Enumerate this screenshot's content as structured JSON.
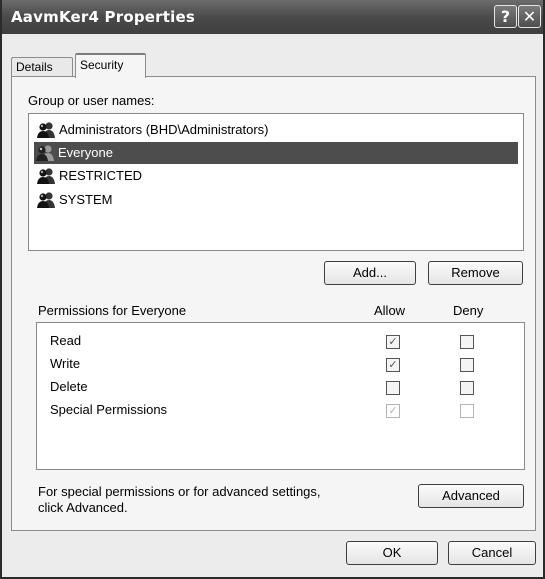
{
  "window": {
    "title": "AavmKer4 Properties",
    "help_glyph": "?",
    "close_glyph": "✕"
  },
  "tabs": [
    {
      "label": "Details",
      "active": false
    },
    {
      "label": "Security",
      "active": true
    }
  ],
  "security": {
    "group_label": "Group or user names:",
    "users": [
      {
        "name": "Administrators (BHD\\Administrators)",
        "icon": "user-group-icon",
        "selected": false
      },
      {
        "name": "Everyone",
        "icon": "user-group-icon",
        "selected": true
      },
      {
        "name": "RESTRICTED",
        "icon": "user-group-icon",
        "selected": false
      },
      {
        "name": "SYSTEM",
        "icon": "user-group-icon",
        "selected": false
      }
    ],
    "add_label": "Add...",
    "remove_label": "Remove",
    "permissions_label": "Permissions for Everyone",
    "allow_header": "Allow",
    "deny_header": "Deny",
    "permissions": [
      {
        "name": "Read",
        "allow": true,
        "deny": false,
        "disabled": false
      },
      {
        "name": "Write",
        "allow": true,
        "deny": false,
        "disabled": false
      },
      {
        "name": "Delete",
        "allow": false,
        "deny": false,
        "disabled": false
      },
      {
        "name": "Special Permissions",
        "allow": true,
        "deny": false,
        "disabled": true
      }
    ],
    "note_line1": "For special permissions or for advanced settings,",
    "note_line2": "click Advanced.",
    "advanced_label": "Advanced"
  },
  "footer": {
    "ok_label": "OK",
    "cancel_label": "Cancel"
  }
}
